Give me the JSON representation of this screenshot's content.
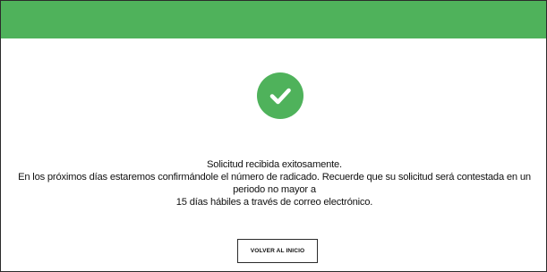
{
  "header": {
    "bar_color": "#4fb25b"
  },
  "status": {
    "icon": "checkmark-circle-icon",
    "icon_color": "#4fb25b",
    "title": "Solicitud recibida exitosamente.",
    "detail_line1": "En los próximos días estaremos confirmándole el número de radicado. Recuerde que su solicitud será contestada en un periodo no mayor a",
    "detail_line2": "15 días hábiles a través de correo electrónico."
  },
  "actions": {
    "home_label": "VOLVER AL INICIO"
  }
}
